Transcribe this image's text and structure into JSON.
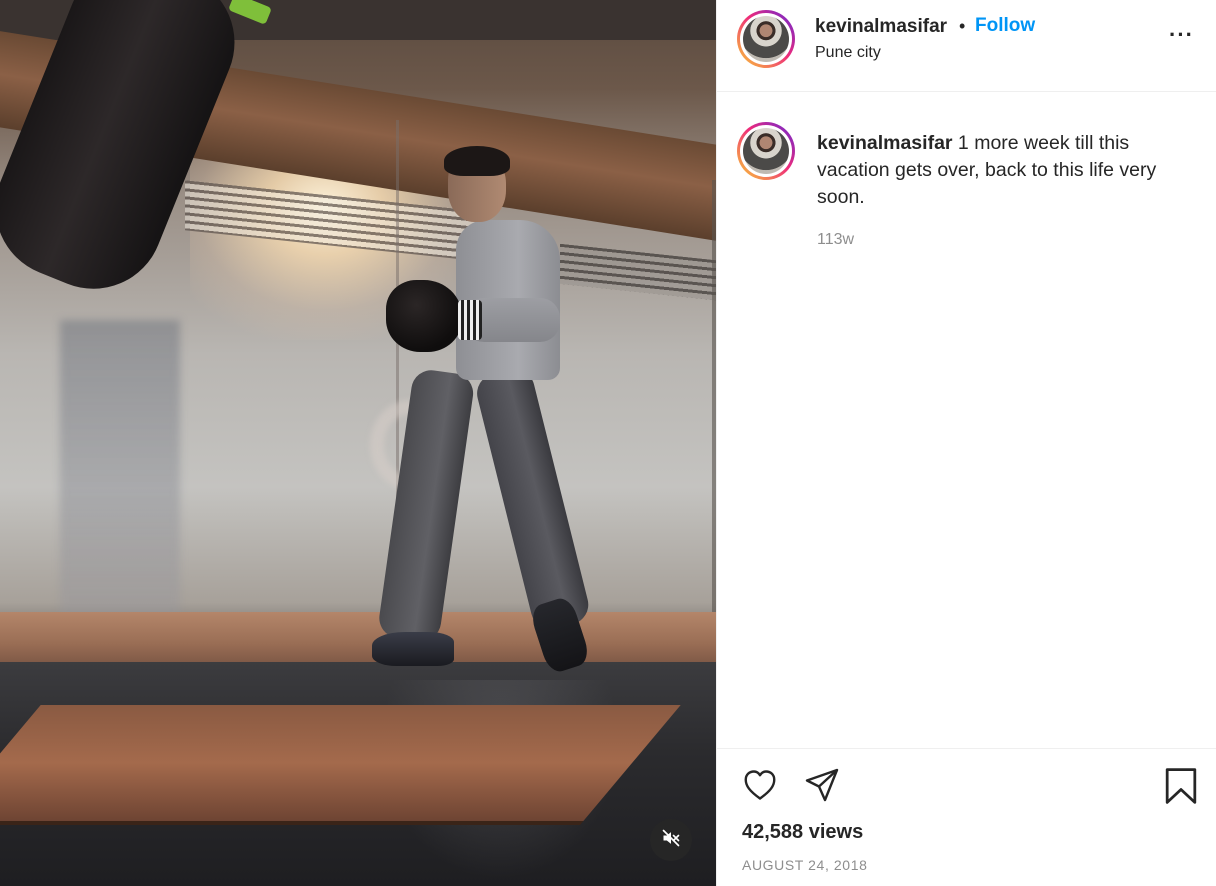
{
  "header": {
    "username": "kevinalmasifar",
    "separator": "•",
    "follow_label": "Follow",
    "location": "Pune city",
    "more_label": "···"
  },
  "caption": {
    "username": "kevinalmasifar",
    "text": " 1 more week till this vacation gets over, back to this life very soon.",
    "timestamp": "113w"
  },
  "footer": {
    "views": "42,588 views",
    "date": "AUGUST 24, 2018"
  },
  "icons": {
    "like": "heart-icon",
    "share": "paper-plane-icon",
    "save": "bookmark-icon",
    "mute": "speaker-muted-icon"
  },
  "colors": {
    "accent": "#0095f6",
    "text": "#262626",
    "muted": "#8e8e8e"
  }
}
